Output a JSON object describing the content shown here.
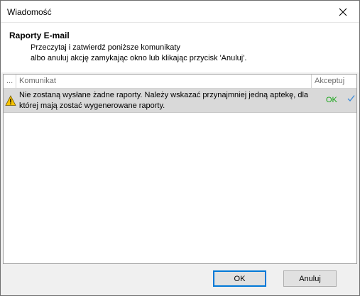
{
  "window": {
    "title": "Wiadomość"
  },
  "header": {
    "title": "Raporty E-mail",
    "line1": "Przeczytaj i zatwierdź poniższe komunikaty",
    "line2": "albo anuluj akcję zamykając okno lub klikając przycisk 'Anuluj'."
  },
  "grid": {
    "columns": [
      "...",
      "Komunikat",
      "Akceptuj"
    ],
    "rows": [
      {
        "icon": "warning-icon",
        "message": "Nie zostaną wysłane żadne raporty. Należy wskazać przynajmniej jedną aptekę, dla której mają zostać wygenerowane raporty.",
        "accept": "OK",
        "checked": true
      }
    ]
  },
  "buttons": {
    "ok": "OK",
    "cancel": "Anuluj"
  },
  "colors": {
    "ok_text": "#17a517",
    "row_bg": "#d9d9d9",
    "focus_border": "#0078d7",
    "check": "#3c8ad8"
  }
}
